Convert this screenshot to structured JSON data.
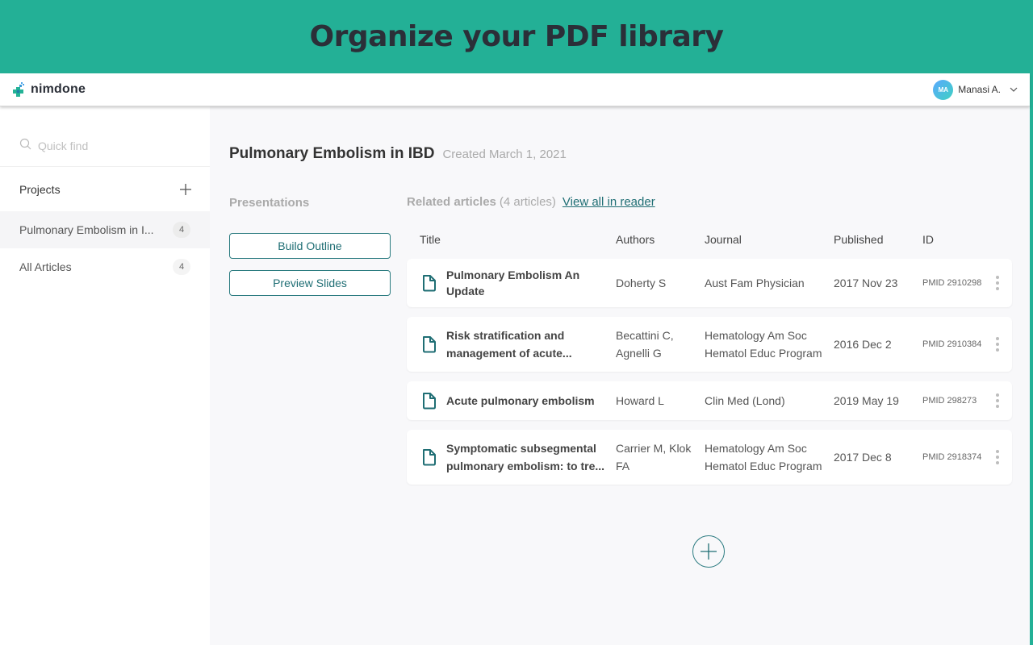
{
  "banner": {
    "headline": "Organize your PDF library"
  },
  "topbar": {
    "brand": "nimdone",
    "user": {
      "initials": "MA",
      "name": "Manasi A."
    }
  },
  "sidebar": {
    "search_placeholder": "Quick find",
    "projects_label": "Projects",
    "items": [
      {
        "label": "Pulmonary Embolism in I...",
        "count": "4",
        "active": true
      },
      {
        "label": "All Articles",
        "count": "4",
        "active": false
      }
    ]
  },
  "project": {
    "title": "Pulmonary Embolism in IBD",
    "created": "Created March 1, 2021"
  },
  "presentations": {
    "label": "Presentations",
    "buttons": [
      "Build Outline",
      "Preview Slides"
    ]
  },
  "related": {
    "label": "Related articles",
    "count": "(4 articles)",
    "view_all": "View all in reader",
    "columns": [
      "Title",
      "Authors",
      "Journal",
      "Published",
      "ID"
    ],
    "rows": [
      {
        "title": "Pulmonary Embolism An Update",
        "authors": "Doherty S",
        "journal": "Aust Fam Physician",
        "published": "2017 Nov 23",
        "id": "PMID 2910298"
      },
      {
        "title": "Risk stratification and management of acute...",
        "authors": "Becattini C, Agnelli G",
        "journal": "Hematology Am Soc Hematol Educ Program",
        "published": "2016 Dec 2",
        "id": "PMID 2910384"
      },
      {
        "title": "Acute pulmonary embolism",
        "authors": "Howard L",
        "journal": "Clin Med (Lond)",
        "published": "2019 May 19",
        "id": "PMID 298273"
      },
      {
        "title": "Symptomatic subsegmental pulmonary embolism: to tre...",
        "authors": "Carrier M, Klok FA",
        "journal": "Hematology Am Soc Hematol Educ Program",
        "published": "2017 Dec 8",
        "id": "PMID 2918374"
      }
    ]
  },
  "colors": {
    "brand": "#23b096",
    "accent": "#1f6e74"
  }
}
